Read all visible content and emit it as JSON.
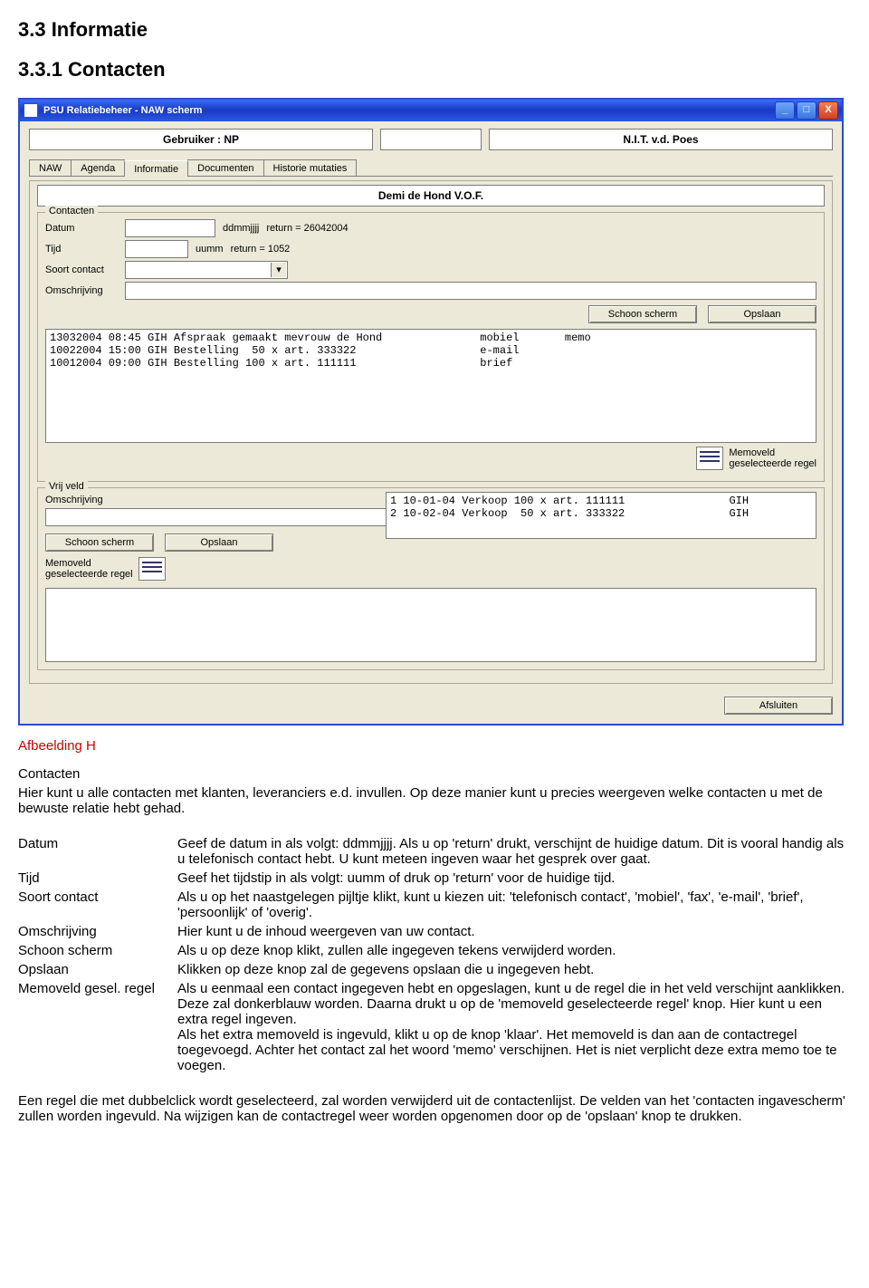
{
  "headings": {
    "sec": "3.3 Informatie",
    "subsec": "3.3.1 Contacten",
    "figure": "Afbeelding H",
    "contact_head": "Contacten",
    "intro": "Hier kunt u alle contacten met klanten, leveranciers e.d. invullen. Op deze manier kunt u precies weergeven welke contacten u met de bewuste relatie hebt gehad."
  },
  "win": {
    "title": "PSU Relatiebeheer  -  NAW scherm",
    "min": "_",
    "max": "□",
    "close": "X",
    "user_label": "Gebruiker : NP",
    "company": "N.I.T. v.d. Poes",
    "tabs": [
      "NAW",
      "Agenda",
      "Informatie",
      "Documenten",
      "Historie mutaties"
    ],
    "active_tab": 2,
    "klant": "Demi de Hond V.O.F.",
    "fieldset_contacten": "Contacten",
    "label_datum": "Datum",
    "hint_datum1": "ddmmjjjj",
    "hint_datum2": "return = 26042004",
    "label_tijd": "Tijd",
    "hint_tijd1": "uumm",
    "hint_tijd2": "return = 1052",
    "label_soort": "Soort contact",
    "label_omschr": "Omschrijving",
    "btn_schoon": "Schoon scherm",
    "btn_opslaan": "Opslaan",
    "listbox": "13032004 08:45 GIH Afspraak gemaakt mevrouw de Hond               mobiel       memo\n10022004 15:00 GIH Bestelling  50 x art. 333322                   e-mail\n10012004 09:00 GIH Bestelling 100 x art. 111111                   brief",
    "memo_label": "Memoveld\ngeselecteerde regel",
    "fieldset_vrij": "Vrij veld",
    "vrij_list": "1 10-01-04 Verkoop 100 x art. 111111                GIH\n2 10-02-04 Verkoop  50 x art. 333322                GIH",
    "btn_afsluiten": "Afsluiten"
  },
  "defs": [
    {
      "term": "Datum",
      "desc": "Geef de datum in als volgt: ddmmjjjj. Als u op 'return' drukt, verschijnt de huidige datum. Dit is vooral handig als u telefonisch contact hebt. U kunt meteen ingeven waar het gesprek over gaat."
    },
    {
      "term": "Tijd",
      "desc": "Geef het tijdstip in als volgt: uumm of druk op 'return' voor de huidige tijd."
    },
    {
      "term": "Soort contact",
      "desc": "Als u op het naastgelegen pijltje klikt, kunt u kiezen uit: 'telefonisch contact', 'mobiel', 'fax', 'e-mail', 'brief', 'persoonlijk' of 'overig'."
    },
    {
      "term": "Omschrijving",
      "desc": "Hier kunt u de inhoud weergeven van uw contact."
    },
    {
      "term": "Schoon scherm",
      "desc": "Als u op deze knop klikt, zullen alle ingegeven tekens verwijderd worden."
    },
    {
      "term": "Opslaan",
      "desc": "Klikken op deze knop zal de gegevens opslaan die u ingegeven hebt."
    },
    {
      "term": "Memoveld gesel. regel",
      "desc": "Als u eenmaal een contact ingegeven hebt en opgeslagen, kunt u de regel die in het veld verschijnt aanklikken. Deze zal donkerblauw worden. Daarna drukt u op de 'memoveld geselecteerde regel' knop. Hier kunt u een extra regel ingeven.\nAls het extra memoveld is ingevuld, klikt u op de knop 'klaar'. Het memoveld is dan aan de contactregel toegevoegd. Achter het contact zal het woord 'memo' verschijnen. Het is niet verplicht deze extra memo toe te voegen."
    }
  ],
  "closing": "Een regel die met dubbelclick wordt geselecteerd, zal worden verwijderd uit de contactenlijst. De velden van het 'contacten ingavescherm' zullen worden ingevuld. Na wijzigen kan de contactregel weer worden opgenomen door op de 'opslaan' knop te drukken."
}
